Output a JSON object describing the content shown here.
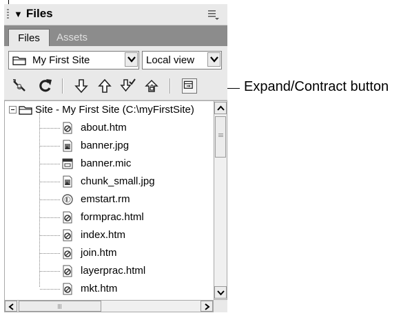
{
  "panel": {
    "title": "Files",
    "options_icon": "options-menu-icon"
  },
  "tabs": [
    {
      "label": "Files",
      "active": true
    },
    {
      "label": "Assets",
      "active": false
    }
  ],
  "site_select": {
    "value": "My First Site"
  },
  "view_select": {
    "value": "Local view"
  },
  "toolbar_icons": [
    "connect-icon",
    "refresh-icon",
    "get-files-icon",
    "put-files-icon",
    "check-out-icon",
    "check-in-icon",
    "expand-contract-icon"
  ],
  "callout": {
    "label": "Expand/Contract button"
  },
  "tree": {
    "root": "Site - My First Site (C:\\myFirstSite)",
    "files": [
      {
        "name": "about.htm",
        "icon": "html-file-icon"
      },
      {
        "name": "banner.jpg",
        "icon": "image-file-icon"
      },
      {
        "name": "banner.mic",
        "icon": "fireworks-file-icon"
      },
      {
        "name": "chunk_small.jpg",
        "icon": "image-file-icon"
      },
      {
        "name": "emstart.rm",
        "icon": "media-file-icon"
      },
      {
        "name": "formprac.html",
        "icon": "html-file-icon"
      },
      {
        "name": "index.htm",
        "icon": "html-file-icon"
      },
      {
        "name": "join.htm",
        "icon": "html-file-icon"
      },
      {
        "name": "layerprac.html",
        "icon": "html-file-icon"
      },
      {
        "name": "mkt.htm",
        "icon": "html-file-icon"
      }
    ]
  },
  "colors": {
    "panel_bg": "#e9e9e9",
    "tab_strip": "#8c8c8c"
  }
}
